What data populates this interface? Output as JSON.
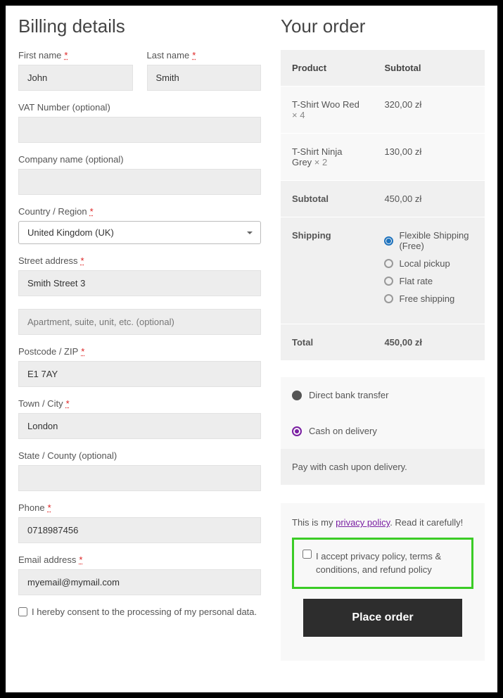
{
  "billing": {
    "heading": "Billing details",
    "first_name": {
      "label": "First name",
      "value": "John"
    },
    "last_name": {
      "label": "Last name",
      "value": "Smith"
    },
    "vat": {
      "label": "VAT Number (optional)",
      "value": ""
    },
    "company": {
      "label": "Company name (optional)",
      "value": ""
    },
    "country": {
      "label": "Country / Region",
      "value": "United Kingdom (UK)"
    },
    "street": {
      "label": "Street address",
      "value": "Smith Street 3",
      "placeholder2": "Apartment, suite, unit, etc. (optional)"
    },
    "postcode": {
      "label": "Postcode / ZIP",
      "value": "E1 7AY"
    },
    "city": {
      "label": "Town / City",
      "value": "London"
    },
    "state": {
      "label": "State / County (optional)",
      "value": ""
    },
    "phone": {
      "label": "Phone",
      "value": "0718987456"
    },
    "email": {
      "label": "Email address",
      "value": "myemail@mymail.com"
    },
    "consent": "I hereby consent to the processing of my personal data."
  },
  "order": {
    "heading": "Your order",
    "th_product": "Product",
    "th_subtotal": "Subtotal",
    "items": [
      {
        "name": "T-Shirt Woo Red",
        "qty": "× 4",
        "subtotal": "320,00 zł"
      },
      {
        "name": "T-Shirt Ninja Grey",
        "qty": "× 2",
        "subtotal": "130,00 zł"
      }
    ],
    "subtotal_label": "Subtotal",
    "subtotal_value": "450,00 zł",
    "shipping_label": "Shipping",
    "shipping_options": [
      {
        "label": "Flexible Shipping (Free)",
        "selected": true
      },
      {
        "label": "Local pickup",
        "selected": false
      },
      {
        "label": "Flat rate",
        "selected": false
      },
      {
        "label": "Free shipping",
        "selected": false
      }
    ],
    "total_label": "Total",
    "total_value": "450,00 zł"
  },
  "payment": {
    "options": [
      {
        "label": "Direct bank transfer",
        "selected": false
      },
      {
        "label": "Cash on delivery",
        "selected": true
      }
    ],
    "description": "Pay with cash upon delivery."
  },
  "privacy": {
    "prefix": "This is my ",
    "link": "privacy policy",
    "suffix": ". Read it carefully!",
    "accept_text": "I accept privacy policy, terms & conditions, and refund policy"
  },
  "place_order_label": "Place order"
}
